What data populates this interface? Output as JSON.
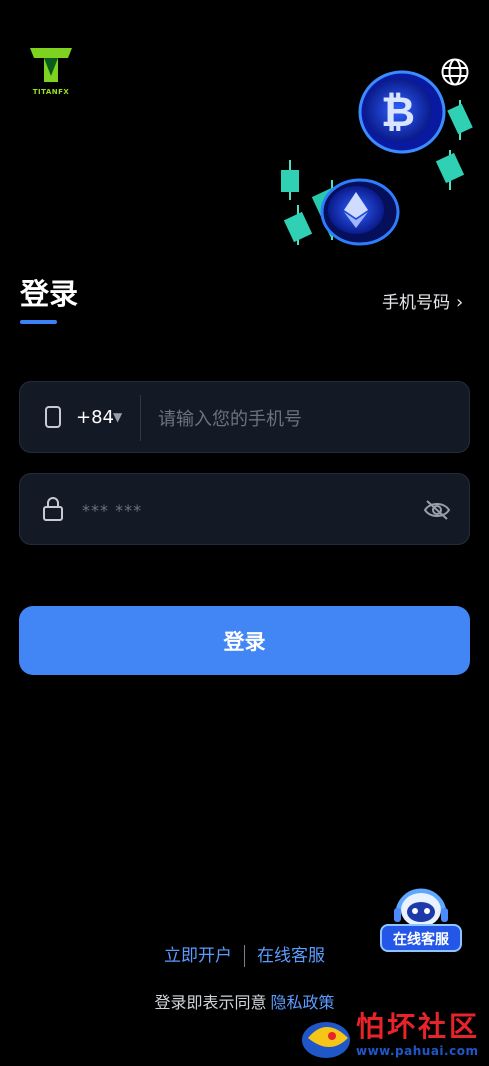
{
  "header": {
    "logo_text": "TITANFX",
    "language_icon": "globe-icon"
  },
  "tabs": {
    "active_label": "登录",
    "alt_label": "手机号码",
    "alt_chevron": "›"
  },
  "phone": {
    "country_code": "+84",
    "dropdown_arrow": "▼",
    "placeholder": "请输入您的手机号",
    "value": "",
    "icon": "phone-icon"
  },
  "password": {
    "placeholder": "*** ***",
    "value": "",
    "icon": "lock-icon",
    "toggle_icon": "eye-off-icon"
  },
  "login_button": "登录",
  "footer": {
    "open_account": "立即开户",
    "online_service": "在线客服",
    "agreement_prefix": "登录即表示同意",
    "privacy_link": "隐私政策"
  },
  "support_widget": {
    "label": "在线客服"
  },
  "watermark": {
    "title": "怕坏社区",
    "url": "www.pahuai.com"
  },
  "colors": {
    "accent": "#4285f4",
    "link": "#5b9cff",
    "field_bg": "#141a25",
    "logo_green": "#9be01b"
  }
}
